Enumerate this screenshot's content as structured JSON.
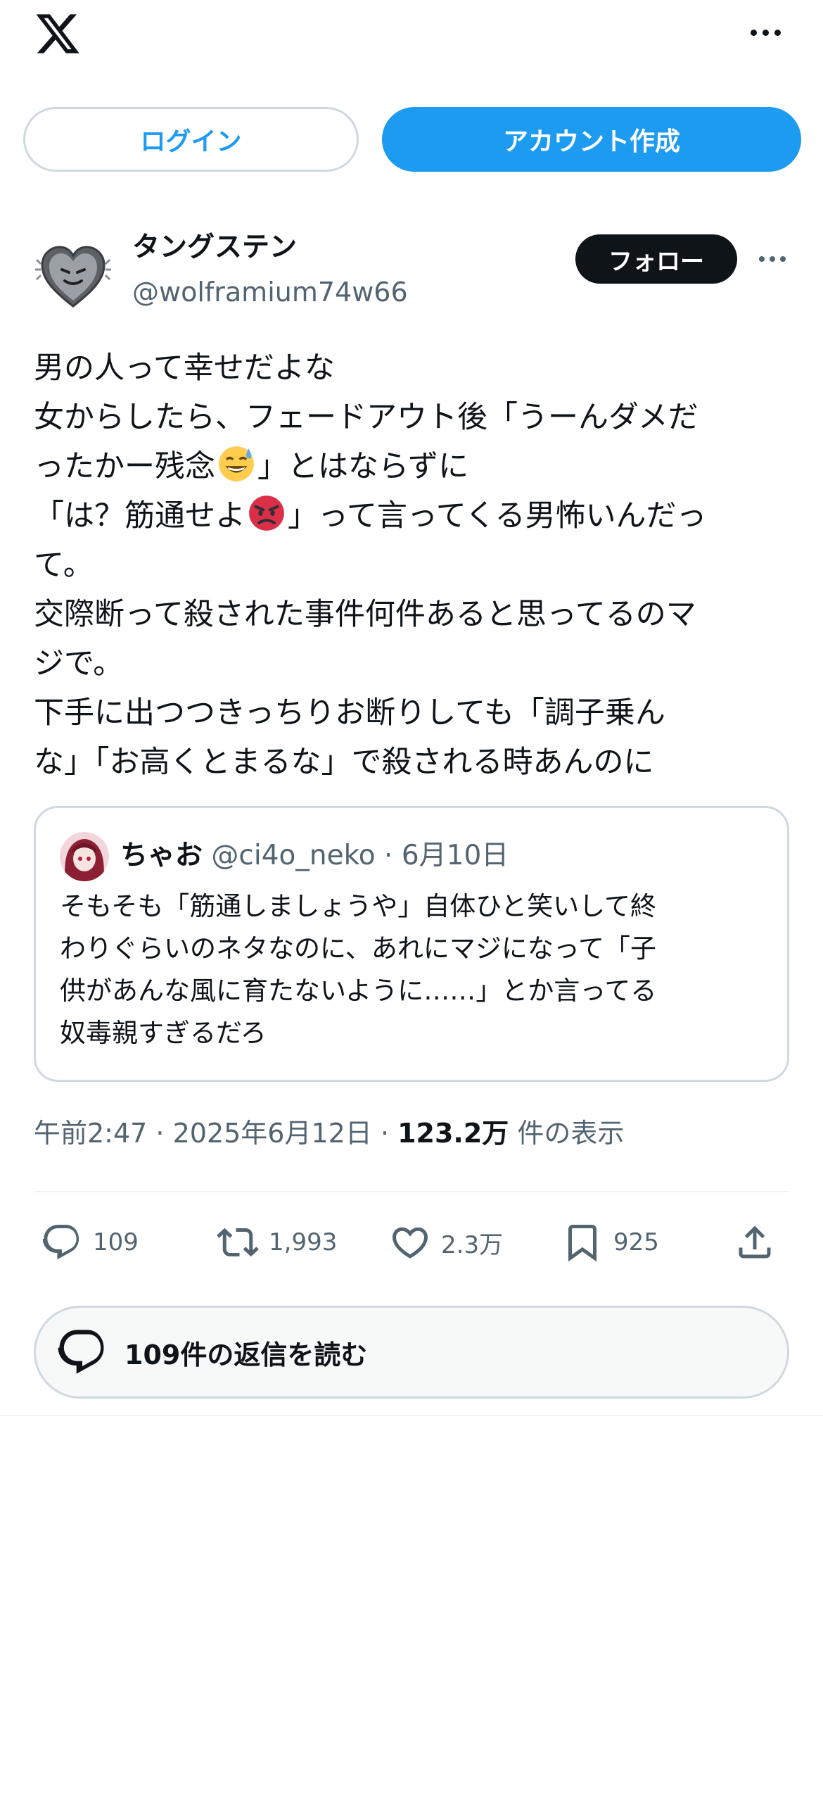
{
  "header": {
    "logo_icon": "x-logo-icon",
    "more_icon": "more-horizontal-icon",
    "login_label": "ログイン",
    "signup_label": "アカウント作成"
  },
  "tweet": {
    "author_name": "タングステン",
    "author_handle": "@wolframium74w66",
    "follow_label": "フォロー",
    "lines": [
      "男の人って幸せだよな",
      "女からしたら、フェードアウト後「うーんダメだ",
      "ったかー残念",
      "」とはならずに",
      "「は？筋通せよ",
      "」って言ってくる男怖いんだっ",
      "て。",
      "交際断って殺された事件何件あると思ってるのマ",
      "ジで。",
      "下手に出つつきっちりお断りしても「調子乗ん",
      "な」「お高くとまるな」で殺される時あんのに"
    ],
    "emoji_1": "grinning-sweat-emoji",
    "emoji_2": "angry-face-emoji",
    "time": "午前2:47",
    "sep": " · ",
    "date": "2025年6月12日",
    "views": "123.2万",
    "views_label": "件の表示"
  },
  "quote": {
    "name": "ちゃお",
    "handle": "@ci4o_neko",
    "date": "6月10日",
    "sep": " · ",
    "lines": [
      "そもそも「筋通しましょうや」自体ひと笑いして終",
      "わりぐらいのネタなのに、あれにマジになって「子",
      "供があんな風に育たないように……」とか言ってる",
      "奴毒親すぎるだろ"
    ]
  },
  "actions": {
    "reply_count": "109",
    "retweet_count": "1,993",
    "like_count": "2.3万",
    "bookmark_count": "925"
  },
  "read_replies_label": "109件の返信を読む",
  "colors": {
    "accent": "#1d9bf0",
    "text": "#0f1419",
    "muted": "#536471",
    "border": "#cfd9de"
  }
}
